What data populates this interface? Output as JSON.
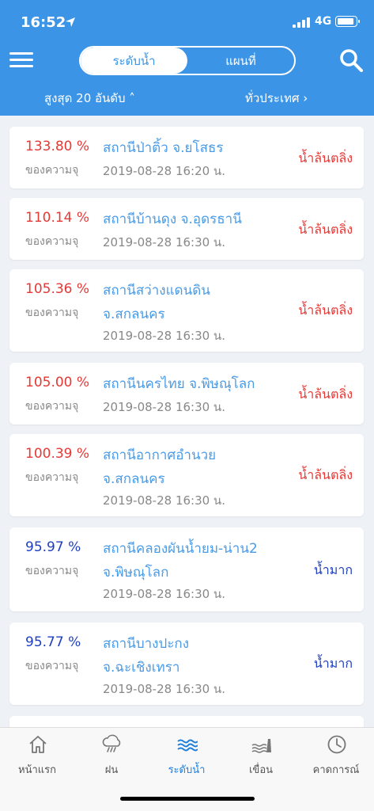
{
  "status_bar": {
    "time": "16:52",
    "network": "4G"
  },
  "header": {
    "segments": [
      "ระดับน้ำ",
      "แผนที่"
    ],
    "active_segment": "ระดับน้ำ",
    "filter_left": "สูงสุด 20 อันดับ ˄",
    "filter_right": "ทั่วประเทศ ›"
  },
  "colors": {
    "header": "#3b94e6",
    "overflow": "#e53935",
    "high": "#1f3fbf",
    "station": "#4a9be6"
  },
  "stations": [
    {
      "percent": "133.80 %",
      "percent_label": "ของความจุ",
      "name_lines": [
        "สถานีป่าติ้ว จ.ยโสธร"
      ],
      "timestamp": "2019-08-28 16:20 น.",
      "status": "น้ำล้นตลิ่ง",
      "level": "overflow"
    },
    {
      "percent": "110.14 %",
      "percent_label": "ของความจุ",
      "name_lines": [
        "สถานีบ้านดุง จ.อุดรธานี"
      ],
      "timestamp": "2019-08-28 16:30 น.",
      "status": "น้ำล้นตลิ่ง",
      "level": "overflow"
    },
    {
      "percent": "105.36 %",
      "percent_label": "ของความจุ",
      "name_lines": [
        "สถานีสว่างแดนดิน",
        "จ.สกลนคร"
      ],
      "timestamp": "2019-08-28 16:30 น.",
      "status": "น้ำล้นตลิ่ง",
      "level": "overflow"
    },
    {
      "percent": "105.00 %",
      "percent_label": "ของความจุ",
      "name_lines": [
        "สถานีนครไทย จ.พิษณุโลก"
      ],
      "timestamp": "2019-08-28 16:30 น.",
      "status": "น้ำล้นตลิ่ง",
      "level": "overflow"
    },
    {
      "percent": "100.39 %",
      "percent_label": "ของความจุ",
      "name_lines": [
        "สถานีอากาศอำนวย",
        "จ.สกลนคร"
      ],
      "timestamp": "2019-08-28 16:30 น.",
      "status": "น้ำล้นตลิ่ง",
      "level": "overflow"
    },
    {
      "percent": "95.97 %",
      "percent_label": "ของความจุ",
      "name_lines": [
        "สถานีคลองผันน้ำยม-น่าน2",
        "จ.พิษณุโลก"
      ],
      "timestamp": "2019-08-28 16:30 น.",
      "status": "น้ำมาก",
      "level": "high"
    },
    {
      "percent": "95.77 %",
      "percent_label": "ของความจุ",
      "name_lines": [
        "สถานีบางปะกง",
        "จ.ฉะเชิงเทรา"
      ],
      "timestamp": "2019-08-28 16:30 น.",
      "status": "น้ำมาก",
      "level": "high"
    }
  ],
  "tab_bar": [
    {
      "label": "หน้าแรก",
      "icon": "home-icon"
    },
    {
      "label": "ฝน",
      "icon": "rain-cloud-icon"
    },
    {
      "label": "ระดับน้ำ",
      "icon": "water-waves-icon",
      "active": true
    },
    {
      "label": "เขื่อน",
      "icon": "dam-icon"
    },
    {
      "label": "คาดการณ์",
      "icon": "clock-icon"
    }
  ]
}
